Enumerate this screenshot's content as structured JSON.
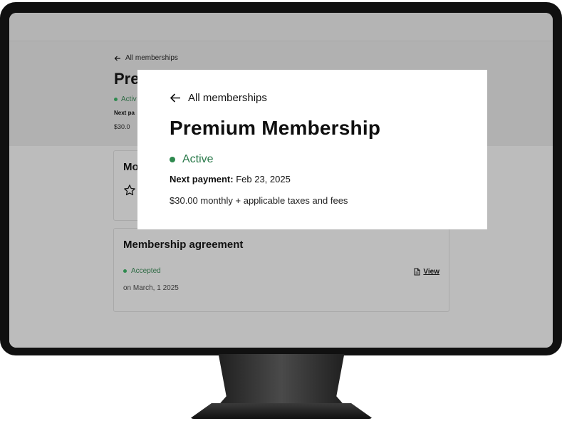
{
  "background_page": {
    "back_link": "All memberships",
    "title": "Premi",
    "status": "Activ",
    "next_payment_partial": "Next pa",
    "price_partial": "$30.0",
    "benefits_card": {
      "title": "Mo"
    },
    "agreement_card": {
      "title": "Membership agreement",
      "status": "Accepted",
      "date": "on March, 1 2025",
      "view_label": "View"
    }
  },
  "focus_card": {
    "back_link": "All memberships",
    "title": "Premium Membership",
    "status": "Active",
    "next_payment_label": "Next payment:",
    "next_payment_value": "Feb 23, 2025",
    "price": "$30.00 monthly + applicable taxes and fees"
  },
  "colors": {
    "accent_green": "#2b7a4b",
    "screen_dim": "#b9b9b9",
    "bezel": "#101010"
  },
  "icons": {
    "back": "arrow-left-icon",
    "benefit": "star-icon",
    "document": "document-icon",
    "status": "status-dot-icon"
  }
}
